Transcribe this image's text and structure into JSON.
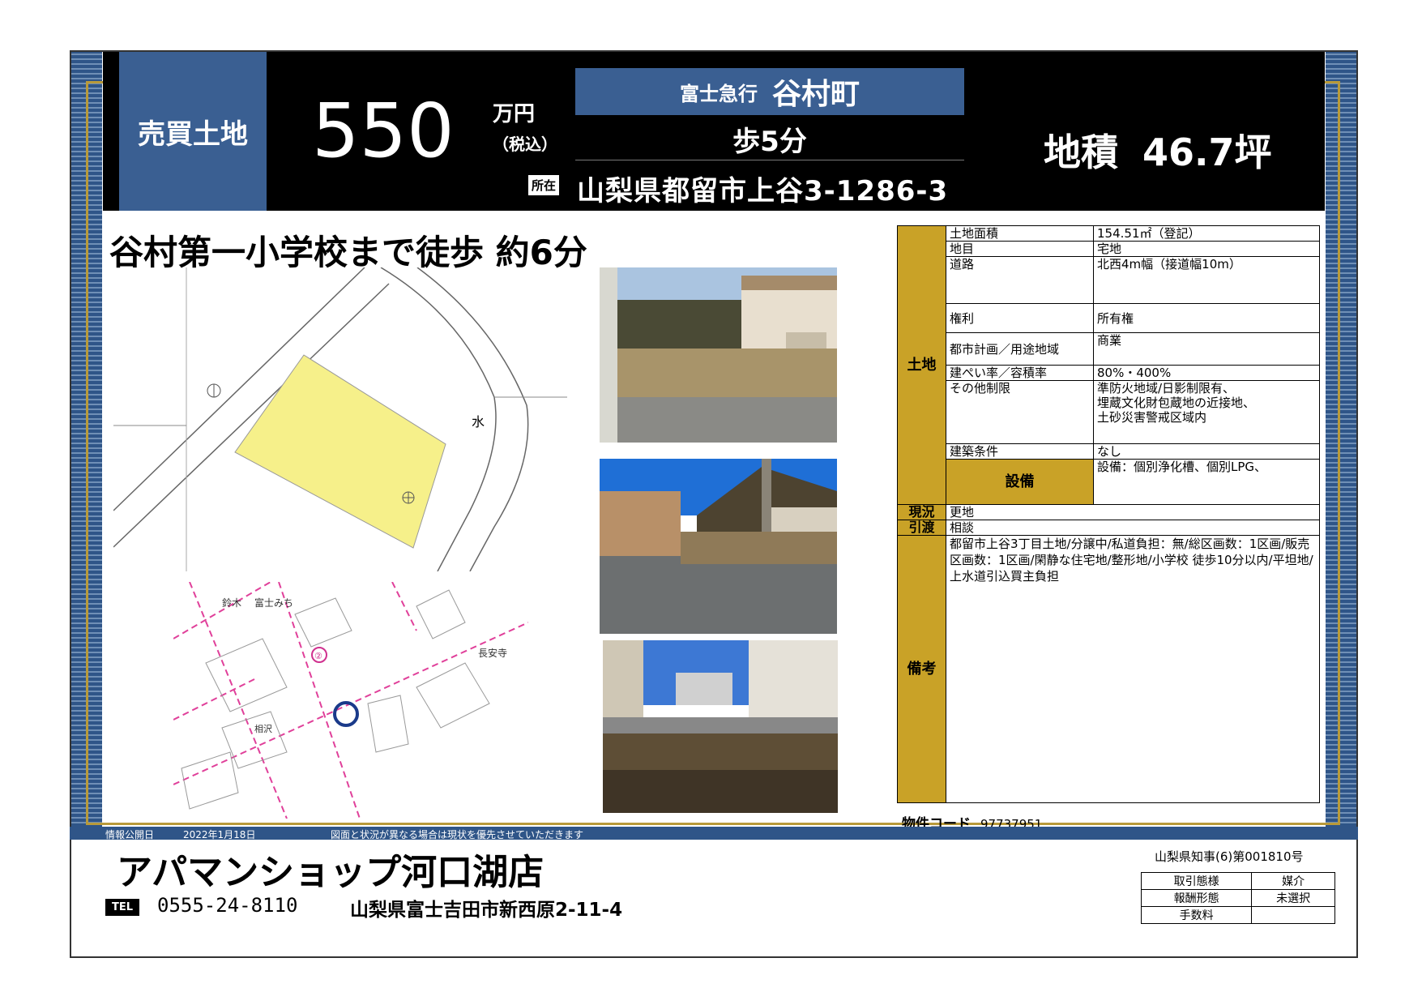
{
  "header": {
    "property_type": "売買土地",
    "price": "550",
    "price_unit": "万円",
    "tax_note": "（税込）",
    "railway": "富士急行",
    "station": "谷村町",
    "walk": "歩5分",
    "location_tag": "所在",
    "address": "山梨県都留市上谷3-1286-3",
    "area_label": "地積",
    "area_value": "46.7坪"
  },
  "headline": "谷村第一小学校まで徒歩 約6分",
  "map_labels": {
    "mizu": "水",
    "suzuki": "鈴木",
    "fuji_michi": "富士みち",
    "choanji": "長安寺",
    "aioi": "相沢",
    "circle_2": "②"
  },
  "spec": {
    "land_category": "土地",
    "rows": [
      {
        "label": "土地面積",
        "value": "154.51㎡（登記）"
      },
      {
        "label": "地目",
        "value": "宅地"
      },
      {
        "label": "道路",
        "value": "北西4m幅（接道幅10m）"
      },
      {
        "label": "権利",
        "value": "所有権"
      },
      {
        "label": "都市計画／用途地域",
        "value": "商業"
      },
      {
        "label": "建ぺい率／容積率",
        "value": "80%・400%"
      },
      {
        "label": "その他制限",
        "value": "準防火地域/日影制限有、\n埋蔵文化財包蔵地の近接地、\n土砂災害警戒区域内"
      },
      {
        "label": "建築条件",
        "value": "なし"
      }
    ],
    "equipment_label": "設備",
    "equipment_value": "設備：個別浄化槽、個別LPG、",
    "status_label": "現況",
    "status_value": "更地",
    "handover_label": "引渡",
    "handover_value": "相談",
    "remarks_label": "備考",
    "remarks_value": "都留市上谷3丁目土地/分譲中/私道負担：無/総区画数：1区画/販売区画数：1区画/閑静な住宅地/整形地/小学校 徒歩10分以内/平坦地/上水道引込買主負担"
  },
  "property_code_label": "物件コード",
  "property_code": "97737951",
  "footer": {
    "publish_label": "情報公開日",
    "publish_date": "2022年1月18日",
    "disclaimer": "図面と状況が異なる場合は現状を優先させていただきます",
    "shop_name": "アパマンショップ河口湖店",
    "tel_tag": "TEL",
    "tel": "0555-24-8110",
    "shop_address": "山梨県富士吉田市新西原2-11-4",
    "license": "山梨県知事(6)第001810号",
    "trade": [
      {
        "label": "取引態様",
        "value": "媒介"
      },
      {
        "label": "報酬形態",
        "value": "未選択"
      },
      {
        "label": "手数料",
        "value": ""
      }
    ]
  },
  "colors": {
    "navy": "#3a5f92",
    "gold": "#c9a227",
    "lot_yellow": "#f6f08a",
    "road_pink": "#e0409a"
  }
}
